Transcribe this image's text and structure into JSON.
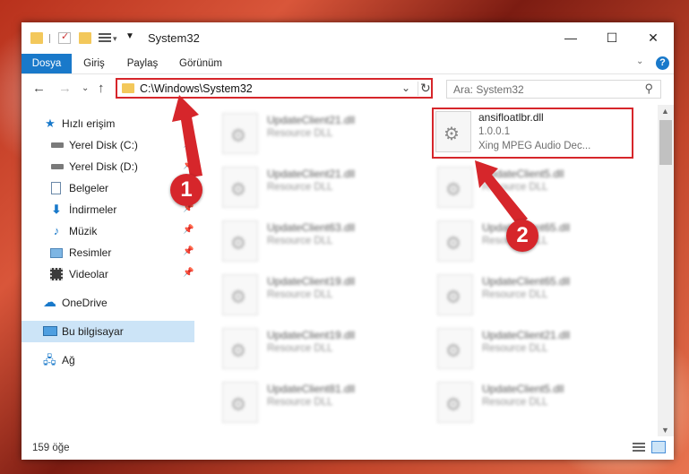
{
  "window": {
    "title": "System32",
    "controls": {
      "minimize": "—",
      "maximize": "☐",
      "close": "✕"
    }
  },
  "ribbon": {
    "tabs": [
      {
        "label": "Dosya",
        "active": true
      },
      {
        "label": "Giriş"
      },
      {
        "label": "Paylaş"
      },
      {
        "label": "Görünüm"
      }
    ],
    "help": "?"
  },
  "address": {
    "path": "C:\\Windows\\System32",
    "search_placeholder": "Ara: System32"
  },
  "sidebar": {
    "items": [
      {
        "label": "Hızlı erişim",
        "icon": "star-icon",
        "pinned": false
      },
      {
        "label": "Yerel Disk (C:)",
        "icon": "drive-icon",
        "pinned": true
      },
      {
        "label": "Yerel Disk (D:)",
        "icon": "drive-icon",
        "pinned": true
      },
      {
        "label": "Belgeler",
        "icon": "documents-icon",
        "pinned": true
      },
      {
        "label": "İndirmeler",
        "icon": "download-icon",
        "pinned": true
      },
      {
        "label": "Müzik",
        "icon": "music-icon",
        "pinned": true
      },
      {
        "label": "Resimler",
        "icon": "pictures-icon",
        "pinned": true
      },
      {
        "label": "Videolar",
        "icon": "video-icon",
        "pinned": true
      },
      {
        "label": "OneDrive",
        "icon": "cloud-icon"
      },
      {
        "label": "Bu bilgisayar",
        "icon": "computer-icon",
        "selected": true
      },
      {
        "label": "Ağ",
        "icon": "network-icon"
      }
    ]
  },
  "files": {
    "highlighted": {
      "name": "ansifloatlbr.dll",
      "version": "1.0.0.1",
      "description": "Xing MPEG Audio Dec..."
    },
    "left_column": [
      {
        "name": "UpdateClient21.dll",
        "type": "Resource DLL"
      },
      {
        "name": "UpdateClient21.dll",
        "type": "Resource DLL"
      },
      {
        "name": "UpdateClient63.dll",
        "type": "Resource DLL"
      },
      {
        "name": "UpdateClient19.dll",
        "type": "Resource DLL"
      },
      {
        "name": "UpdateClient19.dll",
        "type": "Resource DLL"
      },
      {
        "name": "UpdateClient81.dll",
        "type": "Resource DLL"
      }
    ],
    "right_column": [
      {
        "name": "UpdateClient5.dll",
        "type": "Resource DLL"
      },
      {
        "name": "UpdateClient65.dll",
        "type": "Resource DLL"
      },
      {
        "name": "UpdateClient65.dll",
        "type": "Resource DLL"
      },
      {
        "name": "UpdateClient21.dll",
        "type": "Resource DLL"
      },
      {
        "name": "UpdateClient5.dll",
        "type": "Resource DLL"
      }
    ]
  },
  "status": {
    "count": "159 öğe"
  },
  "annotations": [
    {
      "number": "1"
    },
    {
      "number": "2"
    }
  ],
  "colors": {
    "accent": "#1979ca",
    "highlight": "#d6262b",
    "selected": "#cce4f7"
  }
}
